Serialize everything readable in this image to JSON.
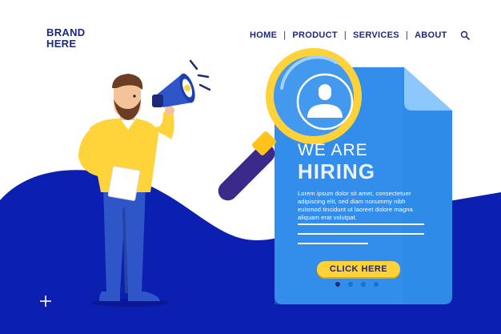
{
  "brand": {
    "line1": "BRAND",
    "line2": "HERE"
  },
  "nav": {
    "items": [
      {
        "label": "HOME"
      },
      {
        "label": "PRODUCT"
      },
      {
        "label": "SERVICES"
      },
      {
        "label": "ABOUT"
      }
    ],
    "separator": "|",
    "search_icon": "search-icon"
  },
  "hero": {
    "line1": "WE ARE",
    "line2": "HIRING",
    "body": "Lorem ipsum dolor sit amet, consectetuer adipiscing elit, sed diam nonummy nibh euismod tincidunt ut laoreet dolore magna aliquam erat volutpat.",
    "cta": "CLICK HERE"
  },
  "carousel": {
    "total": 4,
    "active": 1
  },
  "colors": {
    "navy": "#1e2a78",
    "wave_blue": "#0b1fb0",
    "doc_blue": "#2f8be8",
    "doc_light": "#5fb0f5",
    "yellow": "#ffd23a",
    "shirt": "#ffd43b",
    "pants": "#2e56c9",
    "magnifier_handle": "#3b2a8a"
  },
  "icons": [
    "megaphone-icon",
    "user-icon",
    "magnifier-icon",
    "document-icon",
    "plus-icon",
    "search-icon"
  ]
}
